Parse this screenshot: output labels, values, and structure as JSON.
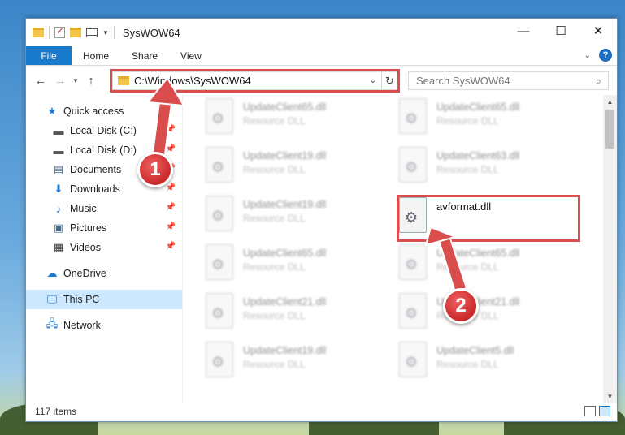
{
  "window": {
    "title": "SysWOW64",
    "controls": {
      "minimize": "—",
      "maximize": "☐",
      "close": "✕"
    }
  },
  "ribbon": {
    "tabs": [
      "File",
      "Home",
      "Share",
      "View"
    ],
    "help": "?"
  },
  "address": {
    "path": "C:\\Windows\\SysWOW64",
    "search_placeholder": "Search SysWOW64"
  },
  "sidebar": {
    "quick_access": "Quick access",
    "items": [
      {
        "label": "Local Disk (C:)",
        "icon": "drive-icon"
      },
      {
        "label": "Local Disk (D:)",
        "icon": "drive-icon"
      },
      {
        "label": "Documents",
        "icon": "documents-icon"
      },
      {
        "label": "Downloads",
        "icon": "downloads-icon"
      },
      {
        "label": "Music",
        "icon": "music-icon"
      },
      {
        "label": "Pictures",
        "icon": "pictures-icon"
      },
      {
        "label": "Videos",
        "icon": "videos-icon"
      }
    ],
    "onedrive": "OneDrive",
    "this_pc": "This PC",
    "network": "Network"
  },
  "files": [
    {
      "name": "UpdateClient65.dll",
      "type": "Resource DLL"
    },
    {
      "name": "UpdateClient65.dll",
      "type": "Resource DLL"
    },
    {
      "name": "UpdateClient19.dll",
      "type": "Resource DLL"
    },
    {
      "name": "UpdateClient63.dll",
      "type": "Resource DLL"
    },
    {
      "name": "UpdateClient19.dll",
      "type": "Resource DLL"
    },
    {
      "name": "avformat.dll",
      "type": ""
    },
    {
      "name": "UpdateClient65.dll",
      "type": "Resource DLL"
    },
    {
      "name": "UpdateClient65.dll",
      "type": "Resource DLL"
    },
    {
      "name": "UpdateClient21.dll",
      "type": "Resource DLL"
    },
    {
      "name": "UpdateClient21.dll",
      "type": "Resource DLL"
    },
    {
      "name": "UpdateClient19.dll",
      "type": "Resource DLL"
    },
    {
      "name": "UpdateClient5.dll",
      "type": "Resource DLL"
    }
  ],
  "status": {
    "count": "117 items"
  },
  "annotations": {
    "step1": "1",
    "step2": "2"
  },
  "colors": {
    "accent": "#1979ca",
    "highlight": "#d94d4d",
    "selection": "#cce8ff"
  }
}
